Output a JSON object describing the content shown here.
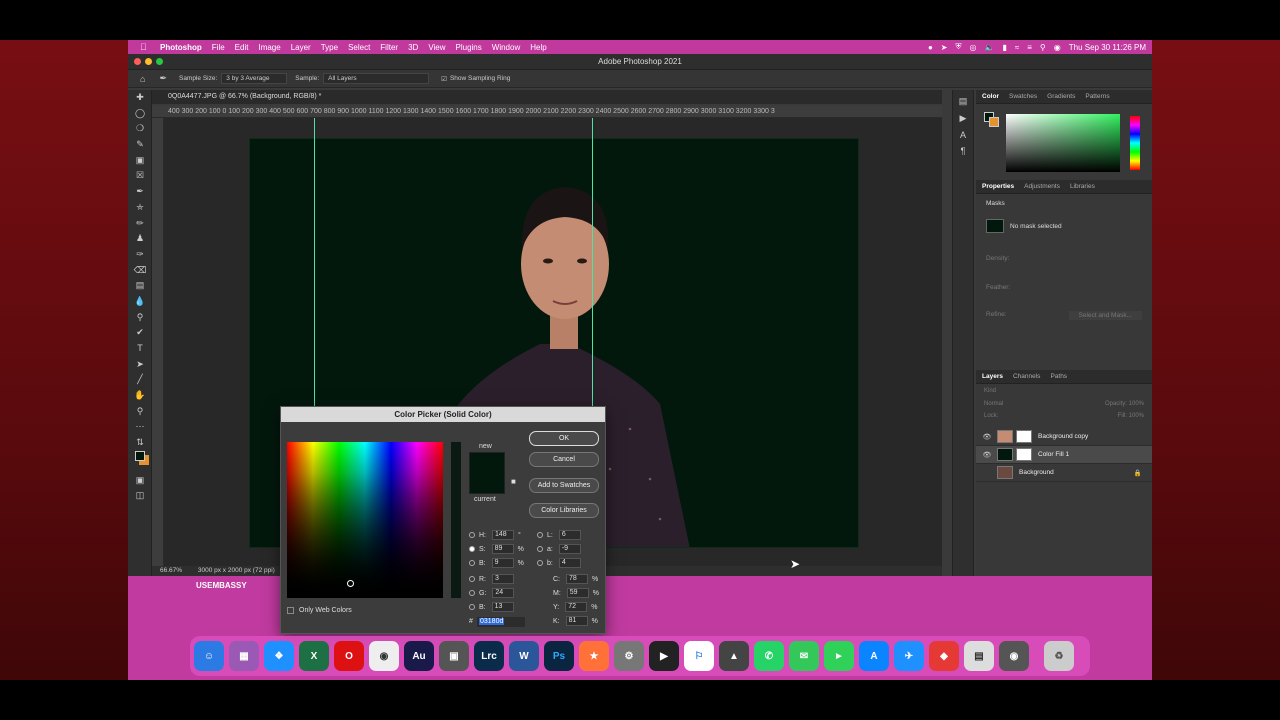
{
  "menubar": {
    "app": "Photoshop",
    "items": [
      "File",
      "Edit",
      "Image",
      "Layer",
      "Type",
      "Select",
      "Filter",
      "3D",
      "View",
      "Plugins",
      "Window",
      "Help"
    ],
    "clock": "Thu Sep 30  11:26 PM"
  },
  "window": {
    "title": "Adobe Photoshop 2021"
  },
  "options": {
    "sample_size_label": "Sample Size:",
    "sample_size_value": "3 by 3 Average",
    "sample_label": "Sample:",
    "sample_value": "All Layers",
    "show_ring_label": "Show Sampling Ring"
  },
  "document": {
    "tab": "0Q0A4477.JPG @ 66.7% (Background, RGB/8) *",
    "ruler": "400  300  200  100  0   100  200  300  400  500  600  700  800  900  1000 1100 1200 1300 1400 1500 1600 1700 1800 1900 2000 2100 2200 2300 2400 2500 2600 2700 2800 2900 3000 3100 3200 3300 3",
    "zoom": "66.67%",
    "size": "3000 px x 2000 px (72 ppi)"
  },
  "color_panel": {
    "tabs": [
      "Color",
      "Swatches",
      "Gradients",
      "Patterns"
    ]
  },
  "properties_panel": {
    "tabs": [
      "Properties",
      "Adjustments",
      "Libraries"
    ],
    "masks": "Masks",
    "no_mask": "No mask selected",
    "density": "Density:",
    "feather": "Feather:",
    "refine": "Refine:",
    "select_mask": "Select and Mask..."
  },
  "layers_panel": {
    "tabs": [
      "Layers",
      "Channels",
      "Paths"
    ],
    "kind": "Kind",
    "blend": "Normal",
    "opacity": "Opacity: 100%",
    "lock": "Lock:",
    "fill": "Fill: 100%",
    "layers": [
      {
        "name": "Background copy",
        "selected": false
      },
      {
        "name": "Color Fill 1",
        "selected": true
      },
      {
        "name": "Background",
        "selected": false
      }
    ]
  },
  "color_picker": {
    "title": "Color Picker (Solid Color)",
    "new_label": "new",
    "current_label": "current",
    "ok": "OK",
    "cancel": "Cancel",
    "add_swatches": "Add to Swatches",
    "color_libraries": "Color Libraries",
    "only_web": "Only Web Colors",
    "h": "148",
    "s": "89",
    "b": "9",
    "r": "3",
    "g": "24",
    "b_rgb": "13",
    "l": "6",
    "a": "-9",
    "b_lab": "4",
    "c": "78",
    "m": "59",
    "y": "72",
    "k": "81",
    "hex": "03180d",
    "h_unit": "°",
    "pct": "%",
    "color": "#03180d"
  },
  "watermark": "USEMBASSY",
  "dock": [
    "Finder",
    "Launchpad",
    "Safari",
    "Excel",
    "Opera",
    "Chrome",
    "Au",
    "Screenshot",
    "Lrc",
    "Word",
    "Ps",
    "Firefox",
    "Settings",
    "Final Cut",
    "Maps",
    "Affinity",
    "WhatsApp",
    "Messages",
    "FaceTime",
    "App Store",
    "TestFlight",
    "AnyDesk",
    "Preview",
    "Capture",
    "Trash"
  ]
}
